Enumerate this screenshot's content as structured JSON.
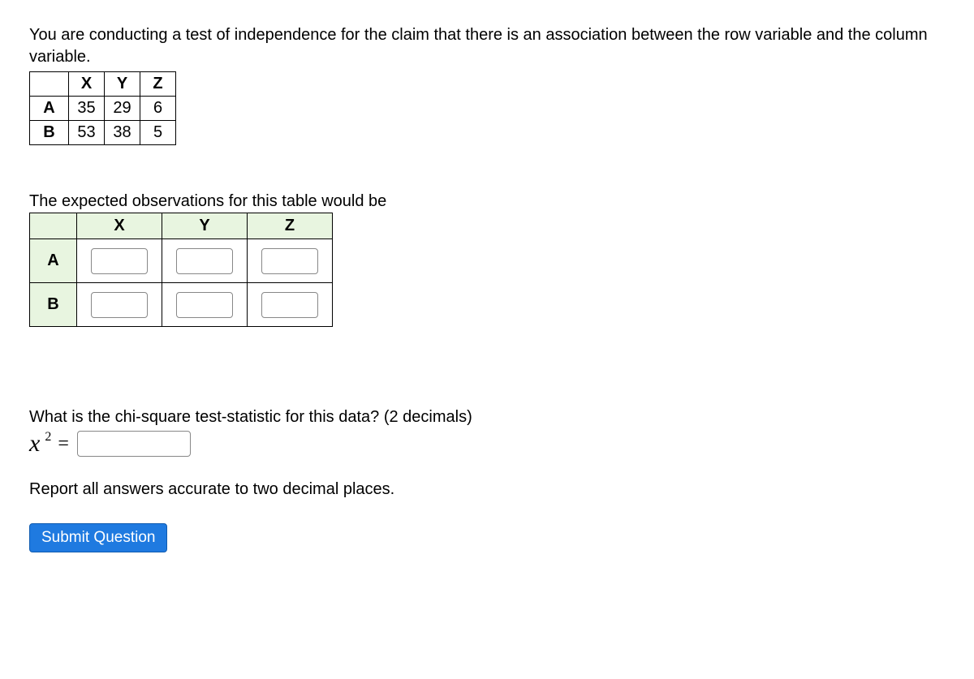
{
  "intro": "You are conducting a test of independence for the claim that there is an association between the row variable and the column variable.",
  "observed": {
    "col_headers": [
      "X",
      "Y",
      "Z"
    ],
    "row_headers": [
      "A",
      "B"
    ],
    "values": [
      [
        35,
        29,
        6
      ],
      [
        53,
        38,
        5
      ]
    ]
  },
  "expected_prompt": "The expected observations for this table would be",
  "expected": {
    "col_headers": [
      "X",
      "Y",
      "Z"
    ],
    "row_headers": [
      "A",
      "B"
    ]
  },
  "chi_prompt": "What is the chi-square test-statistic for this data? (2 decimals)",
  "chi_symbol": "x",
  "chi_sup": "2",
  "chi_eq": "=",
  "report": "Report all answers accurate to two decimal places.",
  "submit_label": "Submit Question"
}
